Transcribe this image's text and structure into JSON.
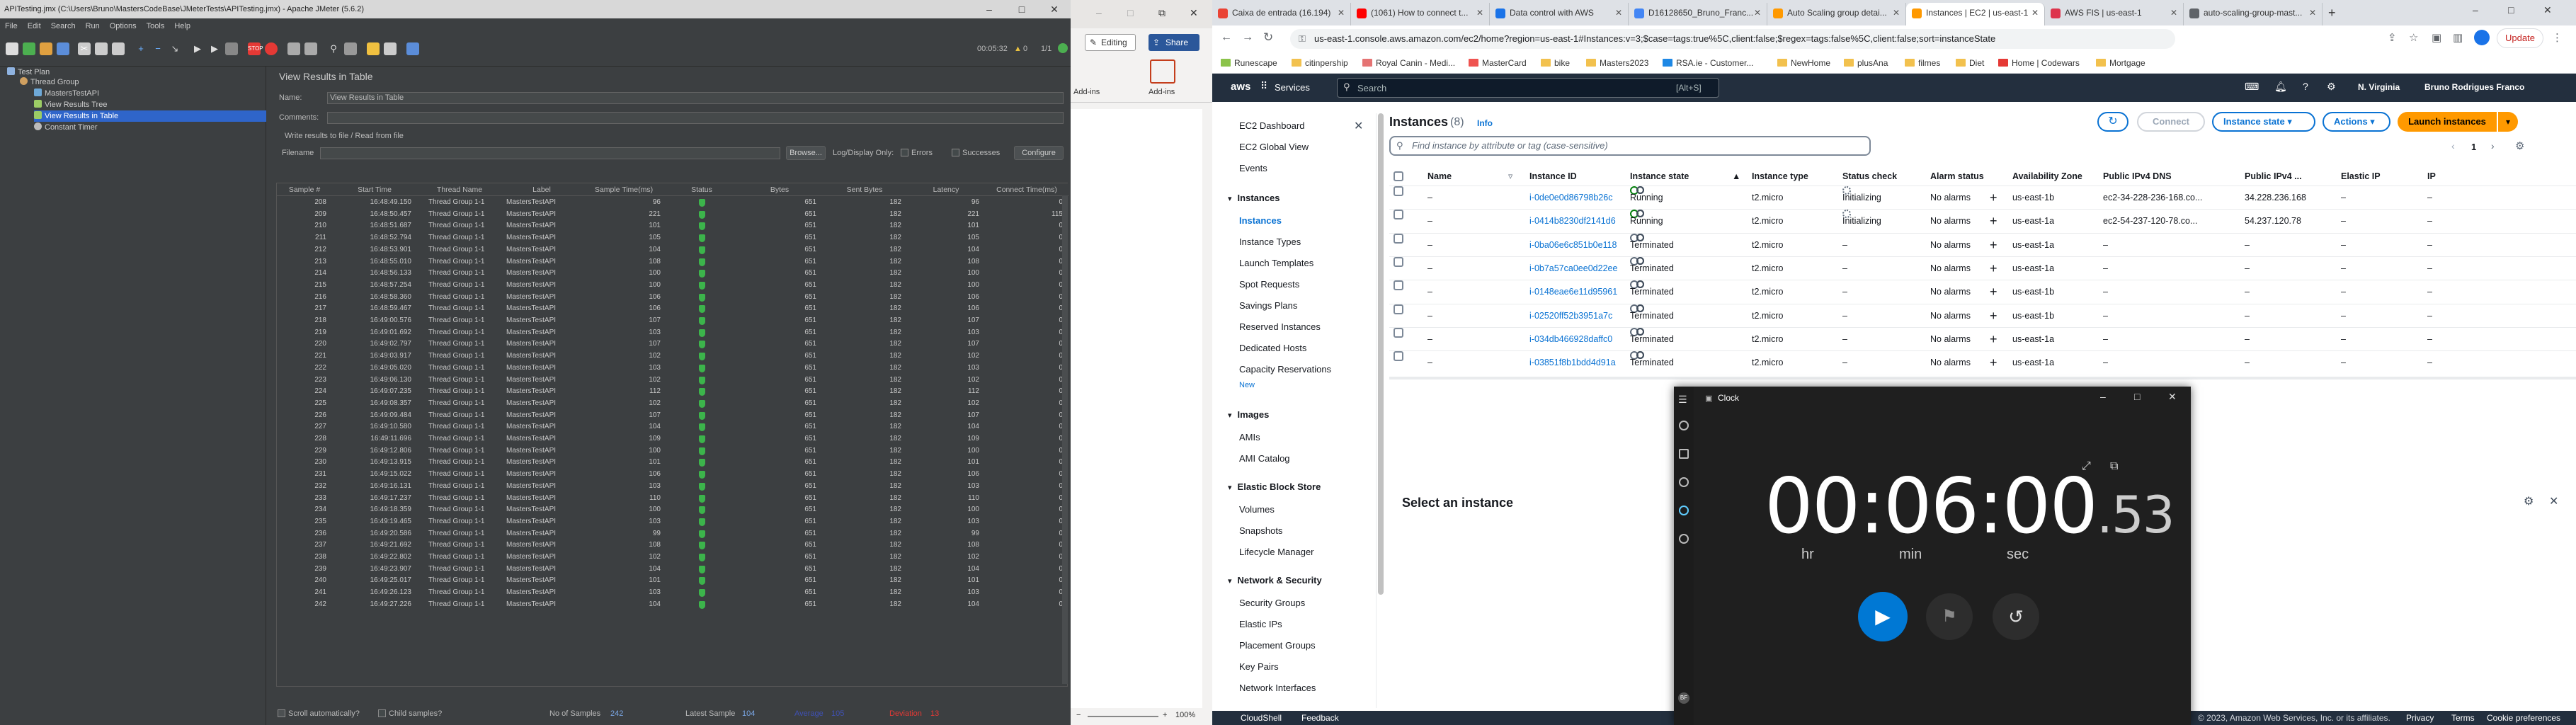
{
  "jmeter": {
    "title": "APITesting.jmx (C:\\Users\\Bruno\\MastersCodeBase\\JMeterTests\\APITesting.jmx) - Apache JMeter (5.6.2)",
    "menu": [
      "File",
      "Edit",
      "Search",
      "Run",
      "Options",
      "Tools",
      "Help"
    ],
    "timer": "00:05:32",
    "warnings": "0",
    "threads": "1/1",
    "tree": [
      {
        "label": "Test Plan",
        "level": 0
      },
      {
        "label": "Thread Group",
        "level": 1
      },
      {
        "label": "MastersTestAPI",
        "level": 2
      },
      {
        "label": "View Results Tree",
        "level": 2
      },
      {
        "label": "View Results in Table",
        "level": 2,
        "selected": true
      },
      {
        "label": "Constant Timer",
        "level": 2
      }
    ],
    "panel_title": "View Results in Table",
    "name_label": "Name:",
    "name_value": "View Results in Table",
    "comments_label": "Comments:",
    "write_results_label": "Write results to file / Read from file",
    "filename_label": "Filename",
    "browse_label": "Browse...",
    "log_display_label": "Log/Display Only:",
    "errors_label": "Errors",
    "successes_label": "Successes",
    "configure_label": "Configure",
    "columns": [
      "Sample #",
      "Start Time",
      "Thread Name",
      "Label",
      "Sample Time(ms)",
      "Status",
      "Bytes",
      "Sent Bytes",
      "Latency",
      "Connect Time(ms)"
    ],
    "rows": [
      [
        "208",
        "16:48:49.150",
        "Thread Group 1-1",
        "MastersTestAPI",
        "96",
        "651",
        "182",
        "96",
        "0"
      ],
      [
        "209",
        "16:48:50.457",
        "Thread Group 1-1",
        "MastersTestAPI",
        "221",
        "651",
        "182",
        "221",
        "115"
      ],
      [
        "210",
        "16:48:51.687",
        "Thread Group 1-1",
        "MastersTestAPI",
        "101",
        "651",
        "182",
        "101",
        "0"
      ],
      [
        "211",
        "16:48:52.794",
        "Thread Group 1-1",
        "MastersTestAPI",
        "105",
        "651",
        "182",
        "105",
        "0"
      ],
      [
        "212",
        "16:48:53.901",
        "Thread Group 1-1",
        "MastersTestAPI",
        "104",
        "651",
        "182",
        "104",
        "0"
      ],
      [
        "213",
        "16:48:55.010",
        "Thread Group 1-1",
        "MastersTestAPI",
        "108",
        "651",
        "182",
        "108",
        "0"
      ],
      [
        "214",
        "16:48:56.133",
        "Thread Group 1-1",
        "MastersTestAPI",
        "100",
        "651",
        "182",
        "100",
        "0"
      ],
      [
        "215",
        "16:48:57.254",
        "Thread Group 1-1",
        "MastersTestAPI",
        "100",
        "651",
        "182",
        "100",
        "0"
      ],
      [
        "216",
        "16:48:58.360",
        "Thread Group 1-1",
        "MastersTestAPI",
        "106",
        "651",
        "182",
        "106",
        "0"
      ],
      [
        "217",
        "16:48:59.467",
        "Thread Group 1-1",
        "MastersTestAPI",
        "106",
        "651",
        "182",
        "106",
        "0"
      ],
      [
        "218",
        "16:49:00.576",
        "Thread Group 1-1",
        "MastersTestAPI",
        "107",
        "651",
        "182",
        "107",
        "0"
      ],
      [
        "219",
        "16:49:01.692",
        "Thread Group 1-1",
        "MastersTestAPI",
        "103",
        "651",
        "182",
        "103",
        "0"
      ],
      [
        "220",
        "16:49:02.797",
        "Thread Group 1-1",
        "MastersTestAPI",
        "107",
        "651",
        "182",
        "107",
        "0"
      ],
      [
        "221",
        "16:49:03.917",
        "Thread Group 1-1",
        "MastersTestAPI",
        "102",
        "651",
        "182",
        "102",
        "0"
      ],
      [
        "222",
        "16:49:05.020",
        "Thread Group 1-1",
        "MastersTestAPI",
        "103",
        "651",
        "182",
        "103",
        "0"
      ],
      [
        "223",
        "16:49:06.130",
        "Thread Group 1-1",
        "MastersTestAPI",
        "102",
        "651",
        "182",
        "102",
        "0"
      ],
      [
        "224",
        "16:49:07.235",
        "Thread Group 1-1",
        "MastersTestAPI",
        "112",
        "651",
        "182",
        "112",
        "0"
      ],
      [
        "225",
        "16:49:08.357",
        "Thread Group 1-1",
        "MastersTestAPI",
        "102",
        "651",
        "182",
        "102",
        "0"
      ],
      [
        "226",
        "16:49:09.484",
        "Thread Group 1-1",
        "MastersTestAPI",
        "107",
        "651",
        "182",
        "107",
        "0"
      ],
      [
        "227",
        "16:49:10.580",
        "Thread Group 1-1",
        "MastersTestAPI",
        "104",
        "651",
        "182",
        "104",
        "0"
      ],
      [
        "228",
        "16:49:11.696",
        "Thread Group 1-1",
        "MastersTestAPI",
        "109",
        "651",
        "182",
        "109",
        "0"
      ],
      [
        "229",
        "16:49:12.806",
        "Thread Group 1-1",
        "MastersTestAPI",
        "100",
        "651",
        "182",
        "100",
        "0"
      ],
      [
        "230",
        "16:49:13.915",
        "Thread Group 1-1",
        "MastersTestAPI",
        "101",
        "651",
        "182",
        "101",
        "0"
      ],
      [
        "231",
        "16:49:15.022",
        "Thread Group 1-1",
        "MastersTestAPI",
        "106",
        "651",
        "182",
        "106",
        "0"
      ],
      [
        "232",
        "16:49:16.131",
        "Thread Group 1-1",
        "MastersTestAPI",
        "103",
        "651",
        "182",
        "103",
        "0"
      ],
      [
        "233",
        "16:49:17.237",
        "Thread Group 1-1",
        "MastersTestAPI",
        "110",
        "651",
        "182",
        "110",
        "0"
      ],
      [
        "234",
        "16:49:18.359",
        "Thread Group 1-1",
        "MastersTestAPI",
        "100",
        "651",
        "182",
        "100",
        "0"
      ],
      [
        "235",
        "16:49:19.465",
        "Thread Group 1-1",
        "MastersTestAPI",
        "103",
        "651",
        "182",
        "103",
        "0"
      ],
      [
        "236",
        "16:49:20.586",
        "Thread Group 1-1",
        "MastersTestAPI",
        "99",
        "651",
        "182",
        "99",
        "0"
      ],
      [
        "237",
        "16:49:21.692",
        "Thread Group 1-1",
        "MastersTestAPI",
        "108",
        "651",
        "182",
        "108",
        "0"
      ],
      [
        "238",
        "16:49:22.802",
        "Thread Group 1-1",
        "MastersTestAPI",
        "102",
        "651",
        "182",
        "102",
        "0"
      ],
      [
        "239",
        "16:49:23.907",
        "Thread Group 1-1",
        "MastersTestAPI",
        "104",
        "651",
        "182",
        "104",
        "0"
      ],
      [
        "240",
        "16:49:25.017",
        "Thread Group 1-1",
        "MastersTestAPI",
        "101",
        "651",
        "182",
        "101",
        "0"
      ],
      [
        "241",
        "16:49:26.123",
        "Thread Group 1-1",
        "MastersTestAPI",
        "103",
        "651",
        "182",
        "103",
        "0"
      ],
      [
        "242",
        "16:49:27.226",
        "Thread Group 1-1",
        "MastersTestAPI",
        "104",
        "651",
        "182",
        "104",
        "0"
      ]
    ],
    "scroll_auto_label": "Scroll automatically?",
    "child_samples_label": "Child samples?",
    "no_samples_label": "No of Samples",
    "no_samples_value": "242",
    "latest_sample_label": "Latest Sample",
    "latest_sample_value": "104",
    "average_label": "Average",
    "average_value": "105",
    "deviation_label": "Deviation",
    "deviation_value": "13"
  },
  "word": {
    "editing_label": "Editing",
    "share_label": "Share",
    "addins_label": "Add-ins",
    "addins2_label": "Add-ins",
    "zoom": "100%"
  },
  "chrome": {
    "tabs": [
      {
        "label": "Caixa de entrada (16.194)",
        "color": "#ea4335"
      },
      {
        "label": "(1061) How to connect t...",
        "color": "#ff0000"
      },
      {
        "label": "Data control with AWS",
        "color": "#1a73e8"
      },
      {
        "label": "D16128650_Bruno_Franc...",
        "color": "#4285f4"
      },
      {
        "label": "Auto Scaling group detai...",
        "color": "#ff9900"
      },
      {
        "label": "Instances | EC2 | us-east-1",
        "color": "#ff9900",
        "active": true
      },
      {
        "label": "AWS FIS | us-east-1",
        "color": "#dd344c"
      },
      {
        "label": "auto-scaling-group-mast...",
        "color": "#5f6368"
      }
    ],
    "url": "us-east-1.console.aws.amazon.com/ec2/home?region=us-east-1#Instances:v=3;$case=tags:true%5C,client:false;$regex=tags:false%5C,client:false;sort=instanceState",
    "update_label": "Update",
    "bookmarks": [
      "Runescape",
      "citinpership",
      "Royal Canin - Medi...",
      "MasterCard",
      "bike",
      "Masters2023",
      "RSA.ie - Customer...",
      "NewHome",
      "plusAna",
      "filmes",
      "Diet",
      "Home | Codewars",
      "Mortgage"
    ]
  },
  "aws": {
    "services_label": "Services",
    "search_placeholder": "Search",
    "search_shortcut": "[Alt+S]",
    "region": "N. Virginia",
    "user": "Bruno Rodrigues Franco",
    "sidebar": {
      "top": [
        "EC2 Dashboard",
        "EC2 Global View",
        "Events"
      ],
      "sections": [
        {
          "title": "Instances",
          "items": [
            "Instances",
            "Instance Types",
            "Launch Templates",
            "Spot Requests",
            "Savings Plans",
            "Reserved Instances",
            "Dedicated Hosts",
            "Capacity Reservations"
          ]
        },
        {
          "title": "Images",
          "items": [
            "AMIs",
            "AMI Catalog"
          ]
        },
        {
          "title": "Elastic Block Store",
          "items": [
            "Volumes",
            "Snapshots",
            "Lifecycle Manager"
          ]
        },
        {
          "title": "Network & Security",
          "items": [
            "Security Groups",
            "Elastic IPs",
            "Placement Groups",
            "Key Pairs",
            "Network Interfaces"
          ]
        }
      ],
      "new_badge": "New"
    },
    "instances_title": "Instances",
    "instances_count": "(8)",
    "info_label": "Info",
    "connect_label": "Connect",
    "instance_state_label": "Instance state",
    "actions_label": "Actions",
    "launch_label": "Launch instances",
    "filter_placeholder": "Find instance by attribute or tag (case-sensitive)",
    "page": "1",
    "columns": [
      "Name",
      "Instance ID",
      "Instance state",
      "Instance type",
      "Status check",
      "Alarm status",
      "Availability Zone",
      "Public IPv4 DNS",
      "Public IPv4 ...",
      "Elastic IP",
      "IP"
    ],
    "rows": [
      {
        "id": "i-0de0e0d86798b26c",
        "state": "Running",
        "type": "t2.micro",
        "check": "Initializing",
        "alarm": "No alarms",
        "az": "us-east-1b",
        "dns": "ec2-34-228-236-168.co...",
        "ip": "34.228.236.168",
        "eip": "–"
      },
      {
        "id": "i-0414b8230df2141d6",
        "state": "Running",
        "type": "t2.micro",
        "check": "Initializing",
        "alarm": "No alarms",
        "az": "us-east-1a",
        "dns": "ec2-54-237-120-78.co...",
        "ip": "54.237.120.78",
        "eip": "–"
      },
      {
        "id": "i-0ba06e6c851b0e118",
        "state": "Terminated",
        "type": "t2.micro",
        "check": "–",
        "alarm": "No alarms",
        "az": "us-east-1a",
        "dns": "–",
        "ip": "–",
        "eip": "–"
      },
      {
        "id": "i-0b7a57ca0ee0d22ee",
        "state": "Terminated",
        "type": "t2.micro",
        "check": "–",
        "alarm": "No alarms",
        "az": "us-east-1a",
        "dns": "–",
        "ip": "–",
        "eip": "–"
      },
      {
        "id": "i-0148eae6e11d95961",
        "state": "Terminated",
        "type": "t2.micro",
        "check": "–",
        "alarm": "No alarms",
        "az": "us-east-1b",
        "dns": "–",
        "ip": "–",
        "eip": "–"
      },
      {
        "id": "i-02520ff52b3951a7c",
        "state": "Terminated",
        "type": "t2.micro",
        "check": "–",
        "alarm": "No alarms",
        "az": "us-east-1b",
        "dns": "–",
        "ip": "–",
        "eip": "–"
      },
      {
        "id": "i-034db466928daffc0",
        "state": "Terminated",
        "type": "t2.micro",
        "check": "–",
        "alarm": "No alarms",
        "az": "us-east-1a",
        "dns": "–",
        "ip": "–",
        "eip": "–"
      },
      {
        "id": "i-03851f8b1bdd4d91a",
        "state": "Terminated",
        "type": "t2.micro",
        "check": "–",
        "alarm": "No alarms",
        "az": "us-east-1a",
        "dns": "–",
        "ip": "–",
        "eip": "–"
      }
    ],
    "select_instance": "Select an instance",
    "footer_cloudshell": "CloudShell",
    "footer_feedback": "Feedback",
    "footer_copyright": "© 2023, Amazon Web Services, Inc. or its affiliates.",
    "footer_links": [
      "Privacy",
      "Terms",
      "Cookie preferences"
    ]
  },
  "clock": {
    "title": "Clock",
    "hours": "00",
    "minutes": "06",
    "seconds": "00",
    "hundredths": ".53",
    "hr_label": "hr",
    "min_label": "min",
    "sec_label": "sec"
  },
  "colors": {
    "aws_orange": "#ff9900",
    "aws_dark": "#232f3e",
    "aws_link": "#0972d3",
    "running": "#037f0c",
    "jmeter_bg": "#3c3f41",
    "clock_play": "#0078d4"
  }
}
